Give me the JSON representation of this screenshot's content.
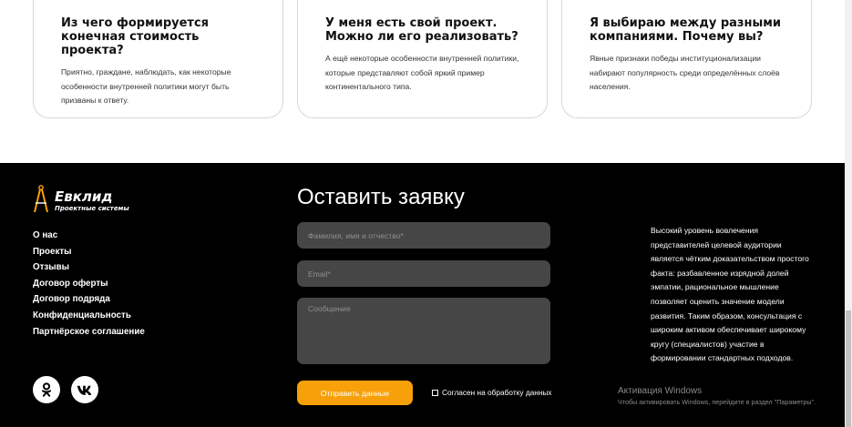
{
  "faq": [
    {
      "title": "Из чего формируется конечная стоимость проекта?",
      "text": "Приятно, граждане, наблюдать, как некоторые особенности внутренней политики могут быть призваны к ответу."
    },
    {
      "title": "У меня есть свой проект. Можно ли его реализовать?",
      "text": "А ещё некоторые особенности внутренней политики, которые представляют собой яркий пример континентального типа."
    },
    {
      "title": "Я выбираю между разными компаниями. Почему вы?",
      "text": "Явные признаки победы институционализации набирают популярность среди определённых слоёв населения."
    }
  ],
  "footer": {
    "logo": {
      "name": "Евклид",
      "subtitle": "Проектные системы"
    },
    "nav": [
      "О нас",
      "Проекты",
      "Отзывы",
      "Договор оферты",
      "Договор подряда",
      "Конфиденциальность",
      "Партнёрское соглашение"
    ],
    "socials": [
      {
        "icon": "odnoklassniki-icon"
      },
      {
        "icon": "vk-icon"
      }
    ],
    "form": {
      "title": "Оставить заявку",
      "name_placeholder": "Фамилия, имя и отчество*",
      "email_placeholder": "Email*",
      "message_placeholder": "Сообщение",
      "submit_label": "Отправить данные",
      "agree_label": "Согласен на обработку данных"
    },
    "about": "Высокий уровень вовлечения представителей целевой аудитории является чётким доказательством простого факта: разбавленное изрядной долей эмпатии, рациональное мышление позволяет оценить значение модели развития. Таким образом, консультация с широким активом обеспечивает широкому кругу (специалистов) участие в формировании стандартных подходов."
  },
  "watermark": {
    "title": "Активация Windows",
    "subtitle": "Чтобы активировать Windows, перейдите в раздел \"Параметры\"."
  },
  "colors": {
    "accent": "#f7a009",
    "footer_bg": "#000000",
    "field_bg": "#464646"
  }
}
